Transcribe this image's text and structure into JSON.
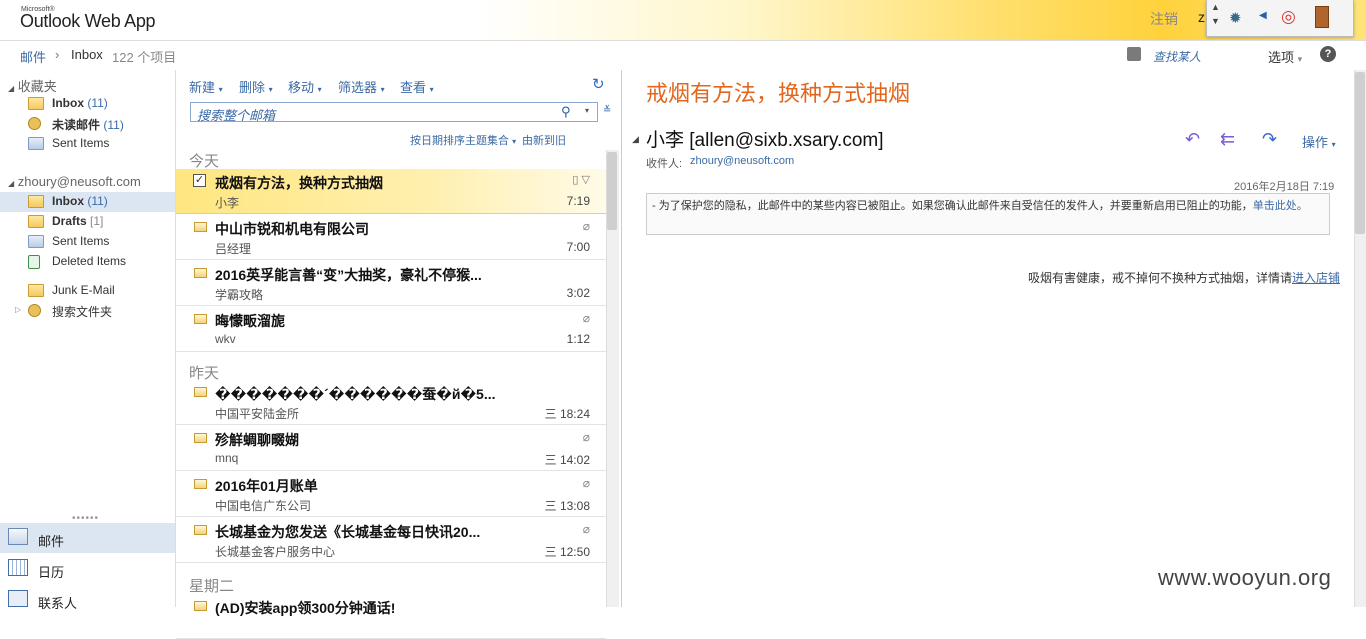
{
  "app": {
    "logo_small": "Microsoft®",
    "logo": "Outlook Web App",
    "logout": "注销",
    "user_trunc": "z"
  },
  "breadcrumb": {
    "mail": "邮件",
    "sep": "›",
    "folder": "Inbox",
    "count": "122 个项目"
  },
  "header_right": {
    "find_person": "查找某人",
    "options": "选项",
    "help": "?"
  },
  "nav": {
    "favorites_title": "收藏夹",
    "favorites": [
      {
        "label": "Inbox",
        "count": "(11)",
        "bold": true
      },
      {
        "label": "未读邮件",
        "count": "(11)",
        "bold": true
      },
      {
        "label": "Sent Items",
        "count": "",
        "bold": false
      }
    ],
    "account_title": "zhoury@neusoft.com",
    "folders": [
      {
        "label": "Inbox",
        "count": "(11)",
        "bold": true
      },
      {
        "label": "Drafts",
        "count": "[1]",
        "bold": true
      },
      {
        "label": "Sent Items",
        "count": "",
        "bold": false
      },
      {
        "label": "Deleted Items",
        "count": "",
        "bold": false
      },
      {
        "label": "Junk E-Mail",
        "count": "",
        "bold": false
      },
      {
        "label": "搜索文件夹",
        "count": "",
        "bold": false
      }
    ],
    "bottom": [
      {
        "label": "邮件"
      },
      {
        "label": "日历"
      },
      {
        "label": "联系人"
      }
    ]
  },
  "toolbar": {
    "new": "新建",
    "delete": "删除",
    "move": "移动",
    "filter": "筛选器",
    "view": "查看"
  },
  "search": {
    "placeholder": "搜索整个邮箱"
  },
  "sort": {
    "by": "按日期排序主题集合",
    "order": "由新到旧"
  },
  "list": {
    "groups": [
      "今天",
      "昨天",
      "星期二"
    ],
    "messages": [
      {
        "subject": "戒烟有方法，换种方式抽烟",
        "from": "小李",
        "time": "7:19",
        "attach": false
      },
      {
        "subject": "中山市锐和机电有限公司",
        "from": "吕经理",
        "time": "7:00",
        "attach": true
      },
      {
        "subject": "2016英孚能言善“变”大抽奖，豪礼不停猴...",
        "from": "学霸攻略",
        "time": "3:02",
        "attach": false
      },
      {
        "subject": "晦懞畈溜旎",
        "from": "wkv",
        "time": "1:12",
        "attach": true
      },
      {
        "subject": "�������´������蚕�й�5...",
        "from": "中国平安陆金所",
        "time": "三 18:24",
        "attach": false
      },
      {
        "subject": "殄觧蜩聊畷媩",
        "from": "mnq",
        "time": "三 14:02",
        "attach": true
      },
      {
        "subject": "2016年01月账单",
        "from": "中国电信广东公司",
        "time": "三 13:08",
        "attach": true
      },
      {
        "subject": "长城基金为您发送《长城基金每日快讯20...",
        "from": "长城基金客户服务中心",
        "time": "三 12:50",
        "attach": true
      },
      {
        "subject": "(AD)安装app领300分钟通话!",
        "from": "",
        "time": "",
        "attach": false
      }
    ]
  },
  "reading": {
    "title": "戒烟有方法，换种方式抽烟",
    "from": "小李 [allen@sixb.xsary.com]",
    "to_label": "收件人:",
    "to": "zhoury@neusoft.com",
    "operations": "操作",
    "date": "2016年2月18日 7:19",
    "notice": "- 为了保护您的隐私，此邮件中的某些内容已被阻止。如果您确认此邮件来自受信任的发件人，并要重新启用已阻止的功能，",
    "notice_link": "单击此处。",
    "body": "吸烟有害健康，戒不掉何不换种方式抽烟，详情请",
    "body_link": "进入店铺"
  },
  "watermark": "www.wooyun.org"
}
